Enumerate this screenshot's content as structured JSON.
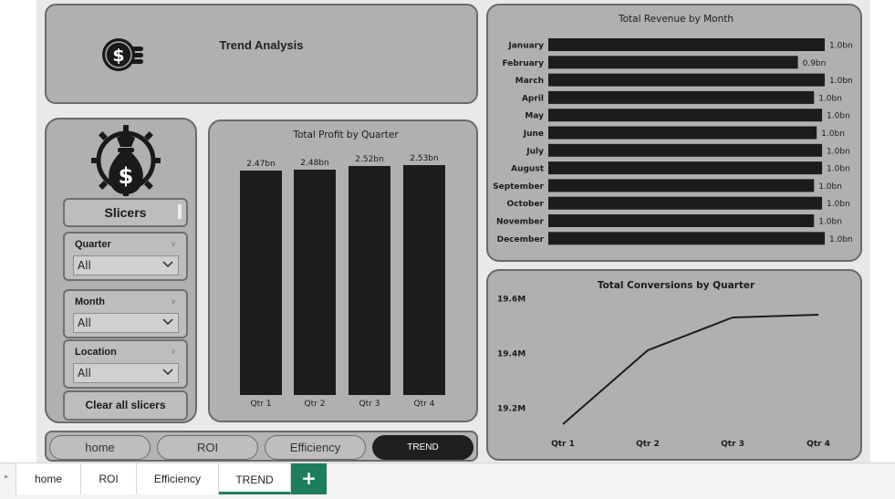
{
  "header": {
    "title": "Trend Analysis",
    "icon": "coin-stack-icon"
  },
  "slicers": {
    "title": "Slicers",
    "icon": "money-bag-gear-icon",
    "cards": [
      {
        "label": "Quarter",
        "value": "All"
      },
      {
        "label": "Month",
        "value": "All"
      },
      {
        "label": "Location",
        "value": "All"
      }
    ],
    "clear_label": "Clear all slicers"
  },
  "nav": {
    "buttons": [
      {
        "label": "home"
      },
      {
        "label": "ROI"
      },
      {
        "label": "Efficiency"
      },
      {
        "label": "TREND"
      }
    ],
    "active": "TREND"
  },
  "page_tabs": {
    "tabs": [
      "home",
      "ROI",
      "Efficiency",
      "TREND"
    ],
    "active": "TREND",
    "add_label": "+",
    "accent": "#1e7d5c"
  },
  "colors": {
    "panel_bg": "#b0b0b0",
    "bar": "#1c1c1c",
    "accent": "#1e7d5c"
  },
  "chart_data": [
    {
      "id": "profit",
      "type": "bar",
      "title": "Total Profit by Quarter",
      "categories": [
        "Qtr 1",
        "Qtr 2",
        "Qtr 3",
        "Qtr 4"
      ],
      "values": [
        2.47,
        2.48,
        2.52,
        2.53
      ],
      "data_labels": [
        "2.47bn",
        "2.48bn",
        "2.52bn",
        "2.53bn"
      ],
      "unit": "bn",
      "ylim": [
        0,
        2.55
      ]
    },
    {
      "id": "revenue",
      "type": "bar",
      "orientation": "horizontal",
      "title": "Total Revenue by Month",
      "categories": [
        "January",
        "February",
        "March",
        "April",
        "May",
        "June",
        "July",
        "August",
        "September",
        "October",
        "November",
        "December"
      ],
      "values": [
        1.03,
        0.93,
        1.03,
        0.99,
        1.02,
        1.0,
        1.02,
        1.02,
        0.99,
        1.02,
        0.99,
        1.03
      ],
      "data_labels": [
        "1.0bn",
        "0.9bn",
        "1.0bn",
        "1.0bn",
        "1.0bn",
        "1.0bn",
        "1.0bn",
        "1.0bn",
        "1.0bn",
        "1.0bn",
        "1.0bn",
        "1.0bn"
      ],
      "unit": "bn",
      "xlim": [
        0,
        1.03
      ]
    },
    {
      "id": "conversions",
      "type": "line",
      "title": "Total Conversions by Quarter",
      "x": [
        "Qtr 1",
        "Qtr 2",
        "Qtr 3",
        "Qtr 4"
      ],
      "values": [
        19.14,
        19.41,
        19.53,
        19.54
      ],
      "yticks": [
        "19.6M",
        "19.4M",
        "19.2M"
      ],
      "ytick_values": [
        19.6,
        19.4,
        19.2
      ],
      "ylim": [
        19.14,
        19.6
      ],
      "unit": "M"
    }
  ]
}
